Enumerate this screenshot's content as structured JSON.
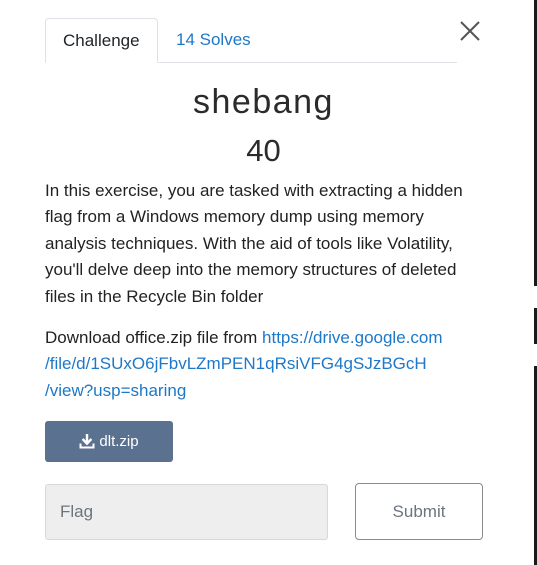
{
  "tabs": [
    {
      "label": "Challenge",
      "active": true
    },
    {
      "label": "14 Solves",
      "active": false
    }
  ],
  "challenge": {
    "name": "shebang",
    "points": "40",
    "description": "In this exercise, you are tasked with extracting a hidden flag from a Windows memory dump using memory analysis techniques. With the aid of tools like Volatility, you'll delve deep into the memory structures of deleted files in the Recycle Bin folder",
    "download_prefix": "Download office.zip file from ",
    "download_link": {
      "line1": "https://drive.google.com",
      "line2": "/file/d/1SUxO6jFbvLZmPEN1qRsiVFG4gSJzBGcH",
      "line3": "/view?usp=sharing"
    },
    "file_button": "dlt.zip"
  },
  "form": {
    "flag_placeholder": "Flag",
    "submit_label": "Submit"
  },
  "icons": {
    "close": "close-icon",
    "download": "download-icon"
  },
  "colors": {
    "link": "#1e78c8",
    "file_button": "#5b7190",
    "input_bg": "#eeeeee"
  }
}
